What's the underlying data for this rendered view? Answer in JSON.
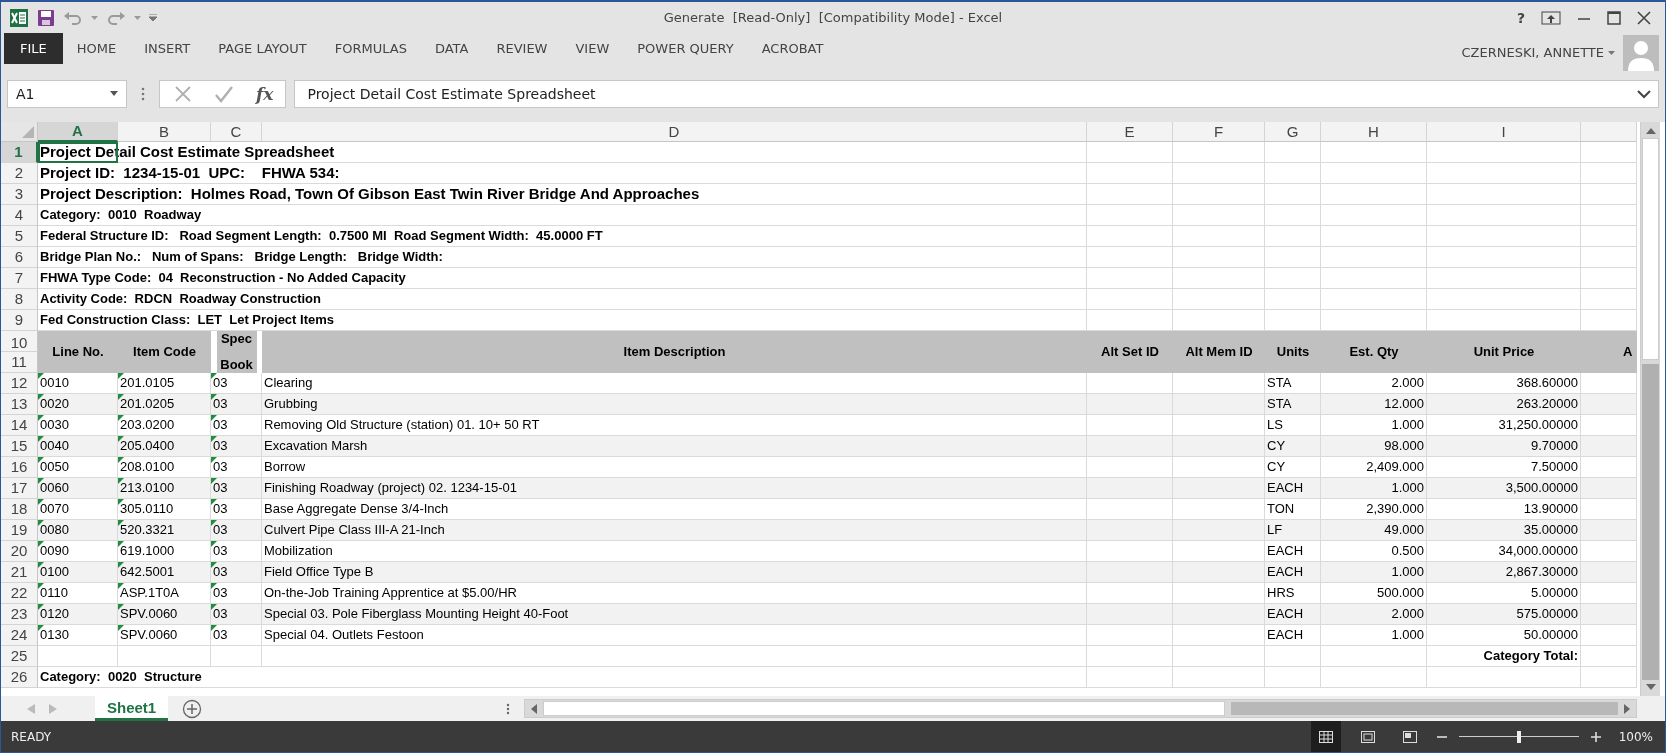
{
  "window": {
    "title": "Generate  [Read-Only]  [Compatibility Mode] - Excel",
    "help_button": "?"
  },
  "ribbon": {
    "file_button": "FILE",
    "tabs": [
      {
        "label": "HOME",
        "selected": false
      },
      {
        "label": "INSERT",
        "selected": false
      },
      {
        "label": "PAGE LAYOUT",
        "selected": false
      },
      {
        "label": "FORMULAS",
        "selected": false
      },
      {
        "label": "DATA",
        "selected": false
      },
      {
        "label": "REVIEW",
        "selected": false
      },
      {
        "label": "VIEW",
        "selected": false
      },
      {
        "label": "POWER QUERY",
        "selected": false
      },
      {
        "label": "ACROBAT",
        "selected": false
      }
    ],
    "user": "CZERNESKI, ANNETTE"
  },
  "formula_bar": {
    "name_box": "A1",
    "function_button": "fx",
    "content": "Project Detail Cost Estimate Spreadsheet"
  },
  "sheet": {
    "columns": [
      {
        "label": "A",
        "selected": true
      },
      {
        "label": "B",
        "selected": false
      },
      {
        "label": "C",
        "selected": false
      },
      {
        "label": "D",
        "selected": false
      },
      {
        "label": "E",
        "selected": false
      },
      {
        "label": "F",
        "selected": false
      },
      {
        "label": "G",
        "selected": false
      },
      {
        "label": "H",
        "selected": false
      },
      {
        "label": "I",
        "selected": false
      }
    ],
    "title_rows": [
      {
        "row": "1",
        "kind": "heading",
        "selected": true,
        "text": "Project Detail Cost Estimate Spreadsheet"
      },
      {
        "row": "2",
        "kind": "heading",
        "selected": false,
        "text": "Project ID:  1234-15-01  UPC:    FHWA 534:"
      },
      {
        "row": "3",
        "kind": "heading",
        "selected": false,
        "text": "Project Description:  Holmes Road, Town Of Gibson East Twin River Bridge And Approaches"
      },
      {
        "row": "4",
        "kind": "info",
        "selected": false,
        "text": "Category:  0010  Roadway"
      },
      {
        "row": "5",
        "kind": "info",
        "selected": false,
        "text": "Federal Structure ID:   Road Segment Length:  0.7500 MI  Road Segment Width:  45.0000 FT"
      },
      {
        "row": "6",
        "kind": "info",
        "selected": false,
        "text": "Bridge Plan No.:   Num of Spans:   Bridge Length:   Bridge Width:"
      },
      {
        "row": "7",
        "kind": "info",
        "selected": false,
        "text": "FHWA Type Code:  04  Reconstruction - No Added Capacity"
      },
      {
        "row": "8",
        "kind": "info",
        "selected": false,
        "text": "Activity Code:  RDCN  Roadway Construction"
      },
      {
        "row": "9",
        "kind": "info",
        "selected": false,
        "text": "Fed Construction Class:  LET  Let Project Items"
      }
    ],
    "header": {
      "rows": [
        "10",
        "11"
      ],
      "cells": [
        "Line No.",
        "Item Code",
        "Spec Book",
        "Item Description",
        "Alt Set ID",
        "Alt Mem ID",
        "Units",
        "Est. Qty",
        "Unit Price",
        "A"
      ]
    },
    "rows": [
      {
        "row": "12",
        "line": "0010",
        "code": "201.0105",
        "book": "03",
        "desc": "Clearing",
        "units": "STA",
        "qty": "2.000",
        "price": "368.60000",
        "error_flag": true
      },
      {
        "row": "13",
        "line": "0020",
        "code": "201.0205",
        "book": "03",
        "desc": "Grubbing",
        "units": "STA",
        "qty": "12.000",
        "price": "263.20000",
        "error_flag": true
      },
      {
        "row": "14",
        "line": "0030",
        "code": "203.0200",
        "book": "03",
        "desc": "Removing Old Structure (station) 01. 10+ 50 RT",
        "units": "LS",
        "qty": "1.000",
        "price": "31,250.00000",
        "error_flag": true
      },
      {
        "row": "15",
        "line": "0040",
        "code": "205.0400",
        "book": "03",
        "desc": "Excavation Marsh",
        "units": "CY",
        "qty": "98.000",
        "price": "9.70000",
        "error_flag": true
      },
      {
        "row": "16",
        "line": "0050",
        "code": "208.0100",
        "book": "03",
        "desc": "Borrow",
        "units": "CY",
        "qty": "2,409.000",
        "price": "7.50000",
        "error_flag": true
      },
      {
        "row": "17",
        "line": "0060",
        "code": "213.0100",
        "book": "03",
        "desc": "Finishing Roadway (project) 02. 1234-15-01",
        "units": "EACH",
        "qty": "1.000",
        "price": "3,500.00000",
        "error_flag": true
      },
      {
        "row": "18",
        "line": "0070",
        "code": "305.0110",
        "book": "03",
        "desc": "Base Aggregate Dense 3/4-Inch",
        "units": "TON",
        "qty": "2,390.000",
        "price": "13.90000",
        "error_flag": true
      },
      {
        "row": "19",
        "line": "0080",
        "code": "520.3321",
        "book": "03",
        "desc": "Culvert Pipe Class III-A 21-Inch",
        "units": "LF",
        "qty": "49.000",
        "price": "35.00000",
        "error_flag": true
      },
      {
        "row": "20",
        "line": "0090",
        "code": "619.1000",
        "book": "03",
        "desc": "Mobilization",
        "units": "EACH",
        "qty": "0.500",
        "price": "34,000.00000",
        "error_flag": true
      },
      {
        "row": "21",
        "line": "0100",
        "code": "642.5001",
        "book": "03",
        "desc": "Field Office Type B",
        "units": "EACH",
        "qty": "1.000",
        "price": "2,867.30000",
        "error_flag": true
      },
      {
        "row": "22",
        "line": "0110",
        "code": "ASP.1T0A",
        "book": "03",
        "desc": "On-the-Job Training Apprentice at $5.00/HR",
        "units": "HRS",
        "qty": "500.000",
        "price": "5.00000",
        "error_flag": true
      },
      {
        "row": "23",
        "line": "0120",
        "code": "SPV.0060",
        "book": "03",
        "desc": "Special 03. Pole Fiberglass Mounting Height 40-Foot",
        "units": "EACH",
        "qty": "2.000",
        "price": "575.00000",
        "error_flag": true
      },
      {
        "row": "24",
        "line": "0130",
        "code": "SPV.0060",
        "book": "03",
        "desc": "Special 04. Outlets Festoon",
        "units": "EACH",
        "qty": "1.000",
        "price": "50.00000",
        "error_flag": true
      }
    ],
    "total_row": {
      "row": "25",
      "label": "Category Total:"
    },
    "category_row": {
      "row": "26",
      "text": "Category:  0020  Structure"
    }
  },
  "sheet_tabs": [
    {
      "label": "Sheet1",
      "selected": true
    }
  ],
  "status_bar": {
    "text": "READY",
    "views": [
      {
        "kind": "normal",
        "selected": true
      },
      {
        "kind": "page-layout",
        "selected": false
      },
      {
        "kind": "page-break",
        "selected": false
      }
    ],
    "zoom_slider": {
      "level": 0.5
    },
    "zoom": "100%"
  }
}
